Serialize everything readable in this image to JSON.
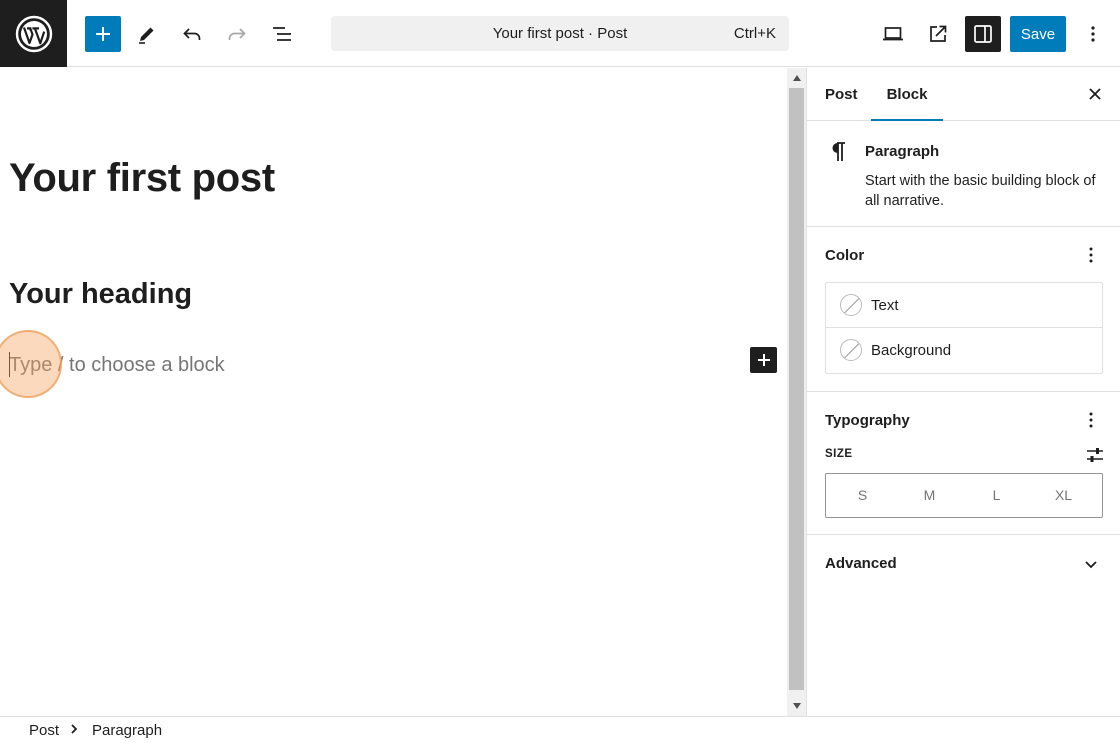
{
  "toolbar": {
    "logo_icon": "wordpress-icon",
    "inserter_icon": "plus-icon",
    "tools_icon": "pencil-icon",
    "undo_icon": "undo-icon",
    "redo_icon": "redo-icon",
    "list_view_icon": "list-view-icon",
    "command_center": {
      "title": "Your first post · Post",
      "shortcut": "Ctrl+K"
    },
    "preview_icon": "desktop-icon",
    "view_post_icon": "external-link-icon",
    "settings_icon": "sidebar-toggle-icon",
    "save_label": "Save",
    "options_icon": "kebab-icon",
    "accent_color": "#007cba"
  },
  "editor": {
    "post_title": "Your first post",
    "heading": "Your heading",
    "paragraph_placeholder": "Type / to choose a block",
    "block_add_icon": "plus-icon"
  },
  "sidebar": {
    "tabs": [
      {
        "label": "Post",
        "active": false
      },
      {
        "label": "Block",
        "active": true
      }
    ],
    "close_icon": "close-icon",
    "block_card": {
      "icon": "paragraph-icon",
      "name": "Paragraph",
      "description": "Start with the basic building block of all narrative."
    },
    "color_panel": {
      "title": "Color",
      "items": [
        {
          "label": "Text"
        },
        {
          "label": "Background"
        }
      ]
    },
    "typography_panel": {
      "title": "Typography",
      "size_label": "SIZE",
      "sizes": [
        "S",
        "M",
        "L",
        "XL"
      ]
    },
    "advanced_panel": {
      "title": "Advanced"
    }
  },
  "footer": {
    "breadcrumbs": [
      "Post",
      "Paragraph"
    ]
  }
}
